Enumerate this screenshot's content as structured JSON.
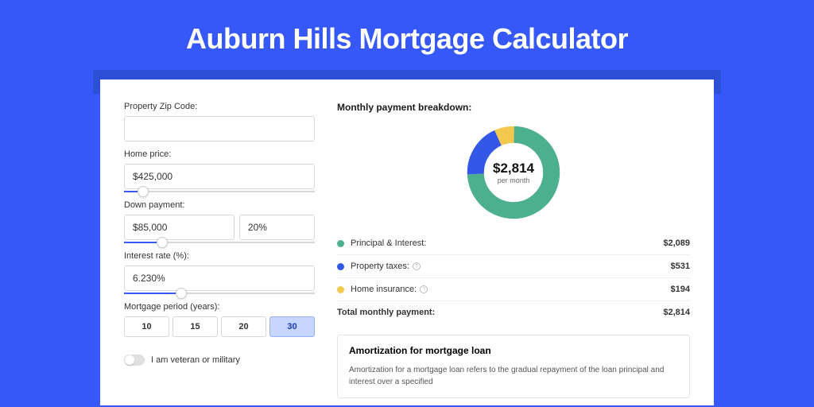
{
  "title": "Auburn Hills Mortgage Calculator",
  "form": {
    "zip_label": "Property Zip Code:",
    "zip_value": "",
    "price_label": "Home price:",
    "price_value": "$425,000",
    "down_label": "Down payment:",
    "down_value": "$85,000",
    "down_pct": "20%",
    "rate_label": "Interest rate (%):",
    "rate_value": "6.230%",
    "period_label": "Mortgage period (years):",
    "periods": [
      "10",
      "15",
      "20",
      "30"
    ],
    "period_active": "30",
    "veteran_label": "I am veteran or military"
  },
  "breakdown": {
    "title": "Monthly payment breakdown:",
    "total_amount": "$2,814",
    "total_sub": "per month",
    "pi_label": "Principal & Interest:",
    "pi_value": "$2,089",
    "tax_label": "Property taxes:",
    "tax_value": "$531",
    "ins_label": "Home insurance:",
    "ins_value": "$194",
    "total_label": "Total monthly payment:",
    "total_value": "$2,814"
  },
  "amort": {
    "title": "Amortization for mortgage loan",
    "body": "Amortization for a mortgage loan refers to the gradual repayment of the loan principal and interest over a specified"
  },
  "colors": {
    "pi": "#4caf8e",
    "tax": "#3557e8",
    "ins": "#f2c94c"
  },
  "chart_data": {
    "type": "pie",
    "title": "Monthly payment breakdown",
    "series": [
      {
        "name": "Principal & Interest",
        "value": 2089,
        "color": "#4caf8e"
      },
      {
        "name": "Property taxes",
        "value": 531,
        "color": "#3557e8"
      },
      {
        "name": "Home insurance",
        "value": 194,
        "color": "#f2c94c"
      }
    ],
    "total": 2814,
    "center_label": "$2,814 per month"
  }
}
